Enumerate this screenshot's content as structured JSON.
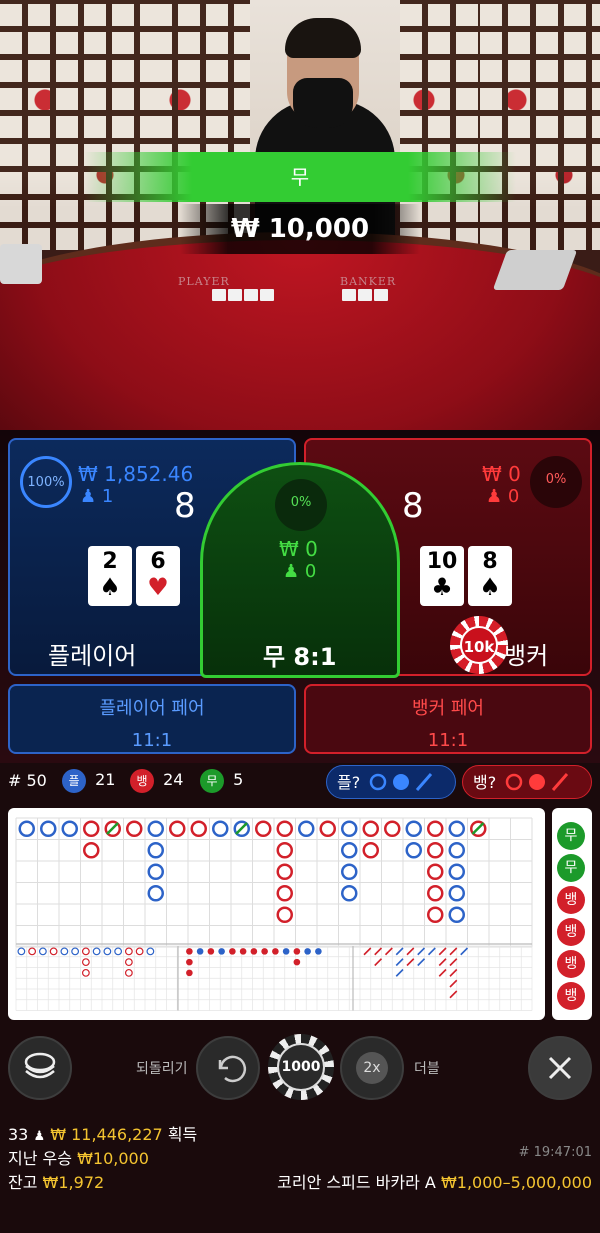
{
  "video": {
    "felt_player_label": "PLAYER",
    "felt_banker_label": "BANKER"
  },
  "result": {
    "outcome_label": "무",
    "win_amount": "₩ 10,000"
  },
  "player": {
    "percent": "100%",
    "bet_total": "₩ 1,852.46",
    "bettors": "1",
    "score": "8",
    "cards": [
      {
        "rank": "2",
        "suit": "♠"
      },
      {
        "rank": "6",
        "suit": "♥"
      }
    ],
    "label": "플레이어"
  },
  "tie": {
    "percent": "0%",
    "bet_total": "₩ 0",
    "bettors": "0",
    "label": "무 8:1"
  },
  "banker": {
    "percent": "0%",
    "bet_total": "₩ 0",
    "bettors": "0",
    "score": "8",
    "cards": [
      {
        "rank": "10",
        "suit": "♣"
      },
      {
        "rank": "8",
        "suit": "♠"
      }
    ],
    "label": "뱅커",
    "chip": "10k"
  },
  "pairs": {
    "player_pair_label": "플레이어 페어",
    "player_pair_odds": "11:1",
    "banker_pair_label": "뱅커 페어",
    "banker_pair_odds": "11:1"
  },
  "stats": {
    "round_label": "# 50",
    "player_glyph": "플",
    "player_count": "21",
    "banker_glyph": "뱅",
    "banker_count": "24",
    "tie_glyph": "무",
    "tie_count": "5",
    "player_predict": "플?",
    "banker_predict": "뱅?"
  },
  "side_road": [
    "무",
    "무",
    "뱅",
    "뱅",
    "뱅",
    "뱅"
  ],
  "controls": {
    "undo_label": "되돌리기",
    "chip_value": "1000",
    "double_icon_text": "2x",
    "double_label": "더블"
  },
  "footer": {
    "winners_count": "33",
    "winners_amount": "₩ 11,446,227",
    "winners_suffix": "획득",
    "last_top_label": "지난 우승",
    "last_top_amount": "₩10,000",
    "balance_label": "잔고",
    "balance_amount": "₩1,972",
    "game_id": "# 19:47:01",
    "table_name": "코리안 스피드 바카라 A",
    "limits": "₩1,000–5,000,000"
  },
  "colors": {
    "player": "#2d63c8",
    "banker": "#d2202a",
    "tie": "#33cc33",
    "gold": "#f4c430"
  }
}
